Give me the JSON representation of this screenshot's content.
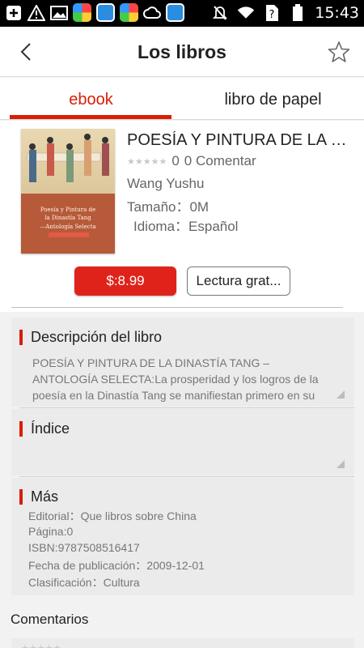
{
  "status_bar": {
    "time": "15:43",
    "icons_left": [
      "add-icon",
      "alert-icon",
      "image-icon",
      "app-icon",
      "app-icon",
      "app-icon",
      "cloud-icon",
      "app-icon"
    ],
    "icons_right": [
      "mute-icon",
      "wifi-icon",
      "no-sim-icon",
      "battery-icon"
    ]
  },
  "navbar": {
    "title": "Los libros",
    "back_icon": "chevron-left-icon",
    "star_icon": "star-outline-icon"
  },
  "tabs": [
    {
      "label": "ebook",
      "active": true
    },
    {
      "label": "libro de papel",
      "active": false
    }
  ],
  "book": {
    "title": "POESÍA Y PINTURA DE LA DI...",
    "rating": "0",
    "comments": "0 Comentar",
    "author": "Wang Yushu",
    "size": "Tamaño：0M",
    "language": "Idioma：Español",
    "cover": {
      "line1": "Poesía y Pintura de",
      "line2": "la Dinastía Tang",
      "line3": "—Antología Selecta"
    }
  },
  "actions": {
    "price": "$:8.99",
    "read": "Lectura grat..."
  },
  "description": {
    "heading": "Descripción del libro",
    "text_lines": [
      "POESÍA Y PINTURA DE LA DINASTÍA TANG –",
      "ANTOLOGÍA SELECTA:La prosperidad y los logros de la",
      "poesía en la Dinastía Tang se manifiestan primero en su"
    ]
  },
  "index": {
    "heading": "Índice"
  },
  "more": {
    "heading": "Más",
    "lines": [
      "Editorial：Que libros sobre China",
      "Página:0",
      "ISBN:9787508516417",
      "Fecha de publicación：2009-12-01",
      "Clasificación：Cultura"
    ]
  },
  "comments": {
    "heading": "Comentarios"
  },
  "colors": {
    "accent": "#d81e06",
    "price_button": "#e0231a"
  }
}
